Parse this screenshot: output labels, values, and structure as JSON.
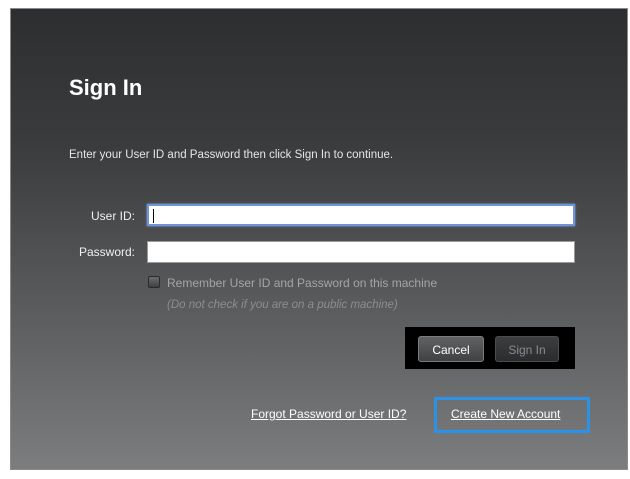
{
  "dialog": {
    "title": "Sign In",
    "instructions": "Enter your User ID and Password then click Sign In to continue."
  },
  "form": {
    "user_id_label": "User ID:",
    "user_id_value": "",
    "password_label": "Password:",
    "password_value": "",
    "remember_label": "Remember User ID and Password on this machine",
    "remember_checked": false,
    "public_note": "(Do not check if you are on a public machine)"
  },
  "buttons": {
    "cancel_label": "Cancel",
    "signin_label": "Sign In"
  },
  "links": {
    "forgot_label": "Forgot Password or User ID?",
    "create_label": "Create New Account"
  },
  "colors": {
    "highlight": "#2a93e8",
    "focus_border": "#6f95d8"
  }
}
